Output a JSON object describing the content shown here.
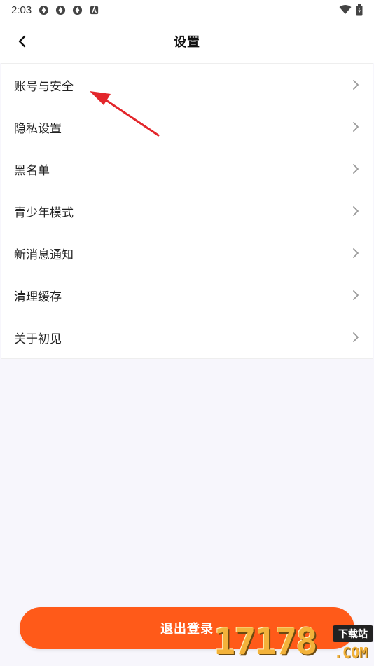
{
  "status_bar": {
    "time": "2:03",
    "icons": [
      "app-icon",
      "app-icon",
      "app-icon",
      "a-badge-icon"
    ],
    "right_icons": [
      "wifi-icon",
      "battery-icon"
    ]
  },
  "header": {
    "title": "设置",
    "back_icon": "chevron-left-icon"
  },
  "menu": {
    "items": [
      {
        "label": "账号与安全"
      },
      {
        "label": "隐私设置"
      },
      {
        "label": "黑名单"
      },
      {
        "label": "青少年模式"
      },
      {
        "label": "新消息通知"
      },
      {
        "label": "清理缓存"
      },
      {
        "label": "关于初见"
      }
    ],
    "chevron_icon": "chevron-right-icon"
  },
  "logout": {
    "label": "退出登录",
    "color": "#ff5a19"
  },
  "annotation": {
    "arrow_color": "#e3262b"
  },
  "watermark": {
    "numbers": "17178",
    "tag": "下载站",
    "domain": ".COM"
  }
}
